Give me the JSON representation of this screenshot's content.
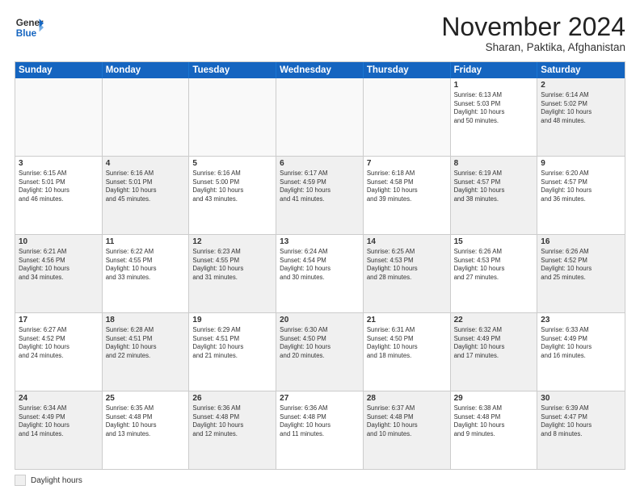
{
  "header": {
    "logo_general": "General",
    "logo_blue": "Blue",
    "month_title": "November 2024",
    "location": "Sharan, Paktika, Afghanistan"
  },
  "calendar": {
    "days_of_week": [
      "Sunday",
      "Monday",
      "Tuesday",
      "Wednesday",
      "Thursday",
      "Friday",
      "Saturday"
    ],
    "rows": [
      [
        {
          "day": "",
          "text": "",
          "empty": true
        },
        {
          "day": "",
          "text": "",
          "empty": true
        },
        {
          "day": "",
          "text": "",
          "empty": true
        },
        {
          "day": "",
          "text": "",
          "empty": true
        },
        {
          "day": "",
          "text": "",
          "empty": true
        },
        {
          "day": "1",
          "text": "Sunrise: 6:13 AM\nSunset: 5:03 PM\nDaylight: 10 hours\nand 50 minutes.",
          "empty": false
        },
        {
          "day": "2",
          "text": "Sunrise: 6:14 AM\nSunset: 5:02 PM\nDaylight: 10 hours\nand 48 minutes.",
          "empty": false,
          "shaded": true
        }
      ],
      [
        {
          "day": "3",
          "text": "Sunrise: 6:15 AM\nSunset: 5:01 PM\nDaylight: 10 hours\nand 46 minutes.",
          "empty": false
        },
        {
          "day": "4",
          "text": "Sunrise: 6:16 AM\nSunset: 5:01 PM\nDaylight: 10 hours\nand 45 minutes.",
          "empty": false,
          "shaded": true
        },
        {
          "day": "5",
          "text": "Sunrise: 6:16 AM\nSunset: 5:00 PM\nDaylight: 10 hours\nand 43 minutes.",
          "empty": false
        },
        {
          "day": "6",
          "text": "Sunrise: 6:17 AM\nSunset: 4:59 PM\nDaylight: 10 hours\nand 41 minutes.",
          "empty": false,
          "shaded": true
        },
        {
          "day": "7",
          "text": "Sunrise: 6:18 AM\nSunset: 4:58 PM\nDaylight: 10 hours\nand 39 minutes.",
          "empty": false
        },
        {
          "day": "8",
          "text": "Sunrise: 6:19 AM\nSunset: 4:57 PM\nDaylight: 10 hours\nand 38 minutes.",
          "empty": false,
          "shaded": true
        },
        {
          "day": "9",
          "text": "Sunrise: 6:20 AM\nSunset: 4:57 PM\nDaylight: 10 hours\nand 36 minutes.",
          "empty": false
        }
      ],
      [
        {
          "day": "10",
          "text": "Sunrise: 6:21 AM\nSunset: 4:56 PM\nDaylight: 10 hours\nand 34 minutes.",
          "empty": false,
          "shaded": true
        },
        {
          "day": "11",
          "text": "Sunrise: 6:22 AM\nSunset: 4:55 PM\nDaylight: 10 hours\nand 33 minutes.",
          "empty": false
        },
        {
          "day": "12",
          "text": "Sunrise: 6:23 AM\nSunset: 4:55 PM\nDaylight: 10 hours\nand 31 minutes.",
          "empty": false,
          "shaded": true
        },
        {
          "day": "13",
          "text": "Sunrise: 6:24 AM\nSunset: 4:54 PM\nDaylight: 10 hours\nand 30 minutes.",
          "empty": false
        },
        {
          "day": "14",
          "text": "Sunrise: 6:25 AM\nSunset: 4:53 PM\nDaylight: 10 hours\nand 28 minutes.",
          "empty": false,
          "shaded": true
        },
        {
          "day": "15",
          "text": "Sunrise: 6:26 AM\nSunset: 4:53 PM\nDaylight: 10 hours\nand 27 minutes.",
          "empty": false
        },
        {
          "day": "16",
          "text": "Sunrise: 6:26 AM\nSunset: 4:52 PM\nDaylight: 10 hours\nand 25 minutes.",
          "empty": false,
          "shaded": true
        }
      ],
      [
        {
          "day": "17",
          "text": "Sunrise: 6:27 AM\nSunset: 4:52 PM\nDaylight: 10 hours\nand 24 minutes.",
          "empty": false
        },
        {
          "day": "18",
          "text": "Sunrise: 6:28 AM\nSunset: 4:51 PM\nDaylight: 10 hours\nand 22 minutes.",
          "empty": false,
          "shaded": true
        },
        {
          "day": "19",
          "text": "Sunrise: 6:29 AM\nSunset: 4:51 PM\nDaylight: 10 hours\nand 21 minutes.",
          "empty": false
        },
        {
          "day": "20",
          "text": "Sunrise: 6:30 AM\nSunset: 4:50 PM\nDaylight: 10 hours\nand 20 minutes.",
          "empty": false,
          "shaded": true
        },
        {
          "day": "21",
          "text": "Sunrise: 6:31 AM\nSunset: 4:50 PM\nDaylight: 10 hours\nand 18 minutes.",
          "empty": false
        },
        {
          "day": "22",
          "text": "Sunrise: 6:32 AM\nSunset: 4:49 PM\nDaylight: 10 hours\nand 17 minutes.",
          "empty": false,
          "shaded": true
        },
        {
          "day": "23",
          "text": "Sunrise: 6:33 AM\nSunset: 4:49 PM\nDaylight: 10 hours\nand 16 minutes.",
          "empty": false
        }
      ],
      [
        {
          "day": "24",
          "text": "Sunrise: 6:34 AM\nSunset: 4:49 PM\nDaylight: 10 hours\nand 14 minutes.",
          "empty": false,
          "shaded": true
        },
        {
          "day": "25",
          "text": "Sunrise: 6:35 AM\nSunset: 4:48 PM\nDaylight: 10 hours\nand 13 minutes.",
          "empty": false
        },
        {
          "day": "26",
          "text": "Sunrise: 6:36 AM\nSunset: 4:48 PM\nDaylight: 10 hours\nand 12 minutes.",
          "empty": false,
          "shaded": true
        },
        {
          "day": "27",
          "text": "Sunrise: 6:36 AM\nSunset: 4:48 PM\nDaylight: 10 hours\nand 11 minutes.",
          "empty": false
        },
        {
          "day": "28",
          "text": "Sunrise: 6:37 AM\nSunset: 4:48 PM\nDaylight: 10 hours\nand 10 minutes.",
          "empty": false,
          "shaded": true
        },
        {
          "day": "29",
          "text": "Sunrise: 6:38 AM\nSunset: 4:48 PM\nDaylight: 10 hours\nand 9 minutes.",
          "empty": false
        },
        {
          "day": "30",
          "text": "Sunrise: 6:39 AM\nSunset: 4:47 PM\nDaylight: 10 hours\nand 8 minutes.",
          "empty": false,
          "shaded": true
        }
      ]
    ]
  },
  "legend": {
    "label": "Daylight hours"
  }
}
